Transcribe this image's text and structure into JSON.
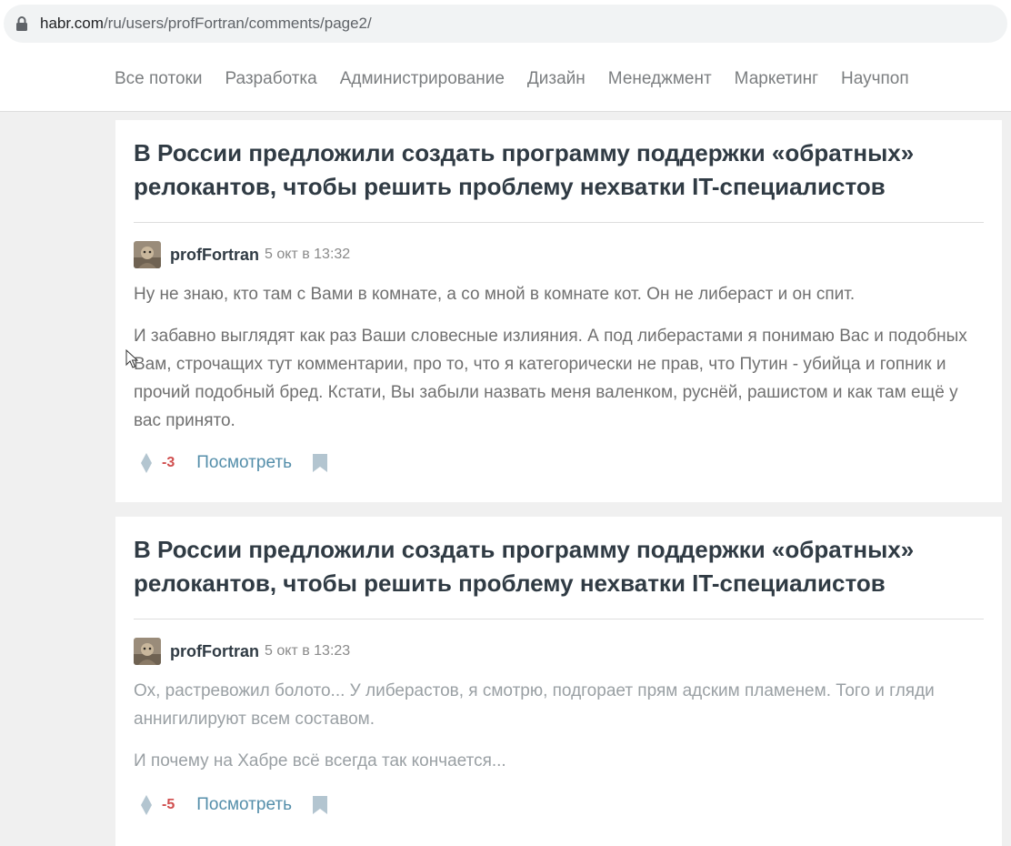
{
  "browser": {
    "url_host": "habr.com",
    "url_path": "/ru/users/profFortran/comments/page2/"
  },
  "nav": {
    "items": [
      "Все потоки",
      "Разработка",
      "Администрирование",
      "Дизайн",
      "Менеджмент",
      "Маркетинг",
      "Научпоп"
    ]
  },
  "comments": [
    {
      "title": "В России предложили создать программу поддержки «обратных» релокантов, чтобы решить проблему нехватки IT-специалистов",
      "author": "profFortran",
      "date": "5 окт в 13:32",
      "paragraphs": [
        "Ну не знаю, кто там с Вами в комнате, а со мной в комнате кот. Он не либераст и он спит.",
        "И забавно выглядят как раз Ваши словесные излияния. А под либерастами я понимаю Вас и подобных Вам, строчащих тут комментарии, про то, что я категорически не прав, что Путин - убийца и гопник и прочий подобный бред. Кстати, Вы забыли назвать меня валенком, руснёй, рашистом и как там ещё у вас принято."
      ],
      "score": "-3",
      "view_label": "Посмотреть"
    },
    {
      "title": "В России предложили создать программу поддержки «обратных» релокантов, чтобы решить проблему нехватки IT-специалистов",
      "author": "profFortran",
      "date": "5 окт в 13:23",
      "paragraphs": [
        "Ох, растревожил болото... У либерастов, я смотрю, подгорает прям адским пламенем. Того и гляди аннигилируют всем составом.",
        "И почему на Хабре всё всегда так кончается..."
      ],
      "score": "-5",
      "view_label": "Посмотреть"
    }
  ],
  "colors": {
    "page_bg": "#f0f0f0",
    "title": "#303b44",
    "link": "#548eaa",
    "negative_score": "#d04e4e"
  },
  "icons": {
    "lock": "lock-icon",
    "vote": "vote-icon",
    "bookmark": "bookmark-icon",
    "cursor": "mouse-cursor-icon"
  }
}
